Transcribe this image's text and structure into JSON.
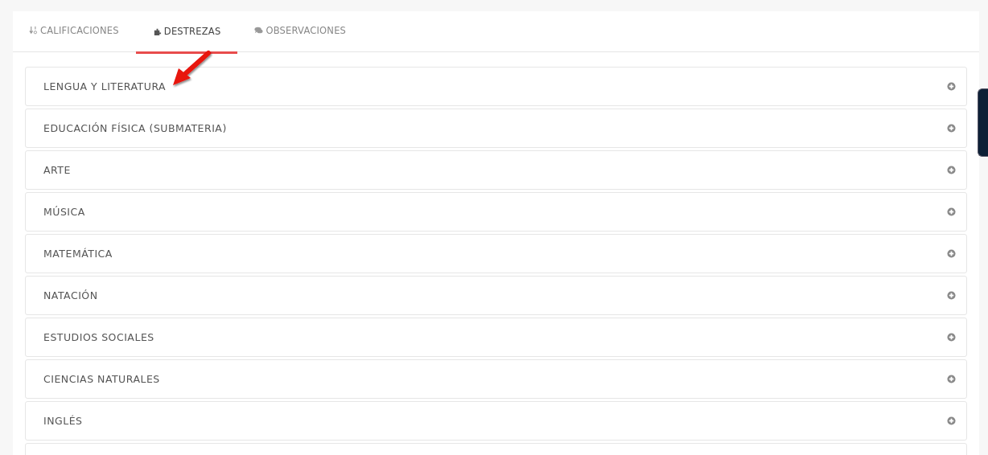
{
  "tabs": [
    {
      "label": "CALIFICACIONES",
      "selected": false
    },
    {
      "label": "DESTREZAS",
      "selected": true
    },
    {
      "label": "OBSERVACIONES",
      "selected": false
    }
  ],
  "panels": [
    {
      "kind": "subject",
      "title": "LENGUA Y LITERATURA",
      "expanded": false
    },
    {
      "kind": "subject",
      "title": "EDUCACIÓN FÍSICA (SUBMATERIA)",
      "expanded": false
    },
    {
      "kind": "subject",
      "title": "ARTE",
      "expanded": false
    },
    {
      "kind": "subject",
      "title": "MÚSICA",
      "expanded": false
    },
    {
      "kind": "subject",
      "title": "MATEMÁTICA",
      "expanded": false
    },
    {
      "kind": "subject",
      "title": "NATACIÓN",
      "expanded": false
    },
    {
      "kind": "subject",
      "title": "ESTUDIOS SOCIALES",
      "expanded": false
    },
    {
      "kind": "subject",
      "title": "CIENCIAS NATURALES",
      "expanded": false
    },
    {
      "kind": "subject",
      "title": "INGLÉS",
      "expanded": false
    },
    {
      "kind": "partial"
    }
  ]
}
